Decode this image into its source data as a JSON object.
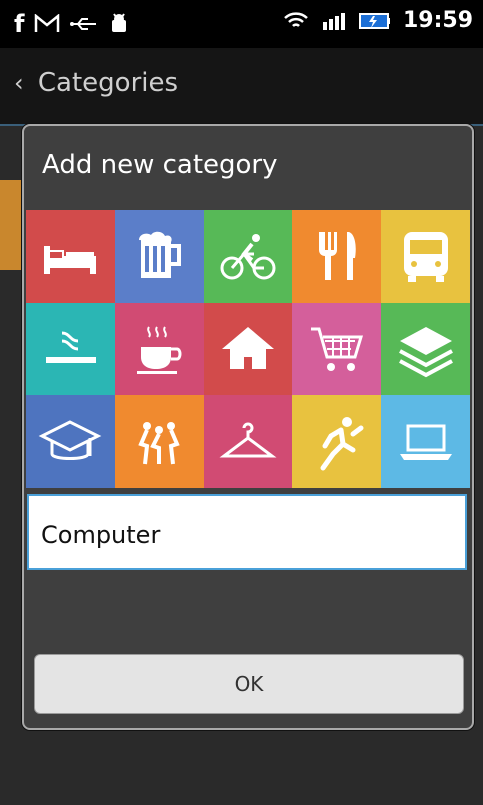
{
  "status_bar": {
    "time": "19:59",
    "icons_left": [
      "facebook-icon",
      "gmail-icon",
      "usb-icon",
      "android-debug-icon"
    ],
    "icons_right": [
      "wifi-icon",
      "signal-icon",
      "battery-icon"
    ]
  },
  "action_bar": {
    "title": "Categories"
  },
  "dialog": {
    "title": "Add new category",
    "input_value": "Computer",
    "ok_label": "OK",
    "tiles": [
      {
        "icon": "bed-icon",
        "color": "#d24b4b"
      },
      {
        "icon": "beer-mug-icon",
        "color": "#5b7ec9"
      },
      {
        "icon": "bicycle-icon",
        "color": "#57b957"
      },
      {
        "icon": "fork-knife-icon",
        "color": "#f08a2f"
      },
      {
        "icon": "bus-icon",
        "color": "#e8c23f"
      },
      {
        "icon": "cigarette-icon",
        "color": "#2bb6b4"
      },
      {
        "icon": "coffee-cup-icon",
        "color": "#d14b73"
      },
      {
        "icon": "home-icon",
        "color": "#d24b4b"
      },
      {
        "icon": "shopping-cart-icon",
        "color": "#d45f9b"
      },
      {
        "icon": "layers-icon",
        "color": "#57b957"
      },
      {
        "icon": "graduation-cap-icon",
        "color": "#4e74bf"
      },
      {
        "icon": "party-icon",
        "color": "#f08a2f"
      },
      {
        "icon": "hanger-icon",
        "color": "#d14b73"
      },
      {
        "icon": "running-icon",
        "color": "#e8c23f"
      },
      {
        "icon": "laptop-icon",
        "color": "#5db9e5"
      }
    ]
  }
}
